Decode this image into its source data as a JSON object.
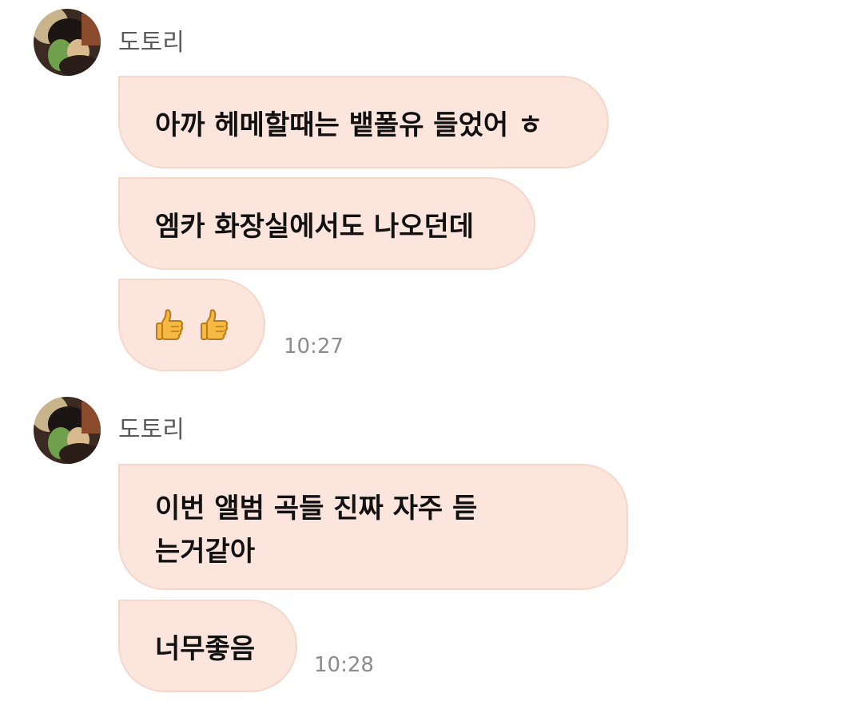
{
  "messages": [
    {
      "sender": "도토리",
      "bubbles": [
        "아까 헤메할때는 뱉폴유 들었어 ㅎ",
        "엠카 화장실에서도 나오던데",
        "👍 👍"
      ],
      "time": "10:27"
    },
    {
      "sender": "도토리",
      "bubbles": [
        "이번 앨범 곡들 진짜 자주 듣는거같아",
        "너무좋음"
      ],
      "time": "10:28"
    }
  ],
  "icons": {
    "avatar": "profile-avatar",
    "reaction": "thumbs-up-icon"
  },
  "colors": {
    "bubble_bg": "#fbe5dc",
    "bubble_border": "#f5d6c8",
    "sender_text": "#5a5a5a",
    "time_text": "#8c8c8c"
  }
}
